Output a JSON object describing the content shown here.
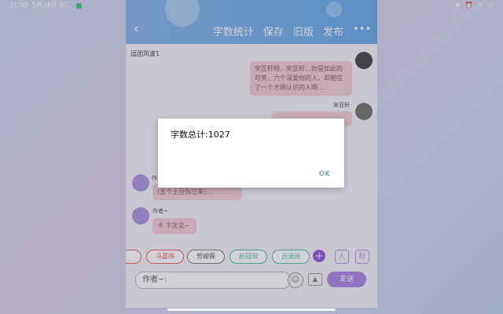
{
  "status_bar": {
    "time": "21:42",
    "date": "5月24日 周二",
    "right_icons": [
      "bluetooth-icon",
      "alarm-icon",
      "wifi-icon",
      "battery-icon"
    ]
  },
  "app": {
    "header": {
      "back_icon": "‹",
      "actions": [
        "字数统计",
        "保存",
        "旧版",
        "发布",
        "•••"
      ]
    },
    "chat_title": "逗团风波1",
    "messages": [
      {
        "side": "right",
        "text": "宋亚轩呀，宋亚轩…你是如此的可笑，六个深爱你的人，却相信了一个才刚认识的人啊…"
      },
      {
        "side": "right",
        "author": "宋亚轩",
        "text": ""
      },
      {
        "side": "left",
        "author": "作",
        "text": "(五个土豆你过来)…"
      },
      {
        "side": "left",
        "author": "作者~",
        "text": "卡 下次见~"
      }
    ],
    "chips": [
      "马嘉祺",
      "贺峻霖",
      "赵冠羽",
      "吕涵涵"
    ],
    "add_label": "+",
    "icon_btn_labels": [
      "人",
      "标"
    ],
    "input": {
      "value": "作者~:"
    },
    "send_label": "发送"
  },
  "dialog": {
    "message": "字数总计:1027",
    "ok_label": "OK"
  },
  "colors": {
    "header": "#6aaae6",
    "bubble": "#f1c9d0",
    "accent": "#8a4ed1",
    "ok": "#1e8a80"
  }
}
